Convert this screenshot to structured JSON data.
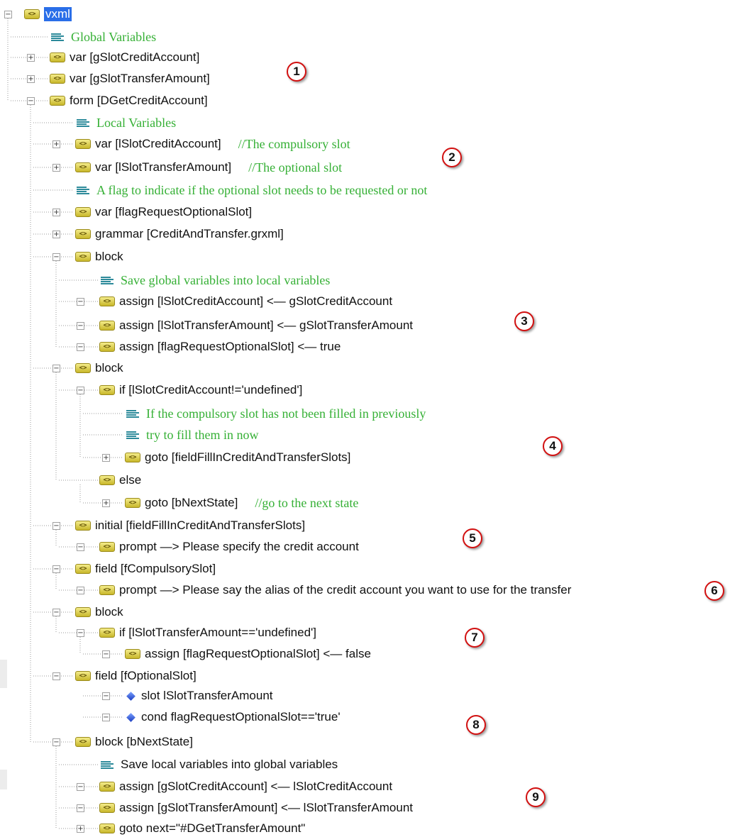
{
  "tree": [
    {
      "depth": 0,
      "icon": "tag",
      "text": "vxml",
      "expander": "minus",
      "selected": true
    },
    {
      "depth": 1,
      "icon": "comment",
      "text": "Global Variables",
      "kind": "comment"
    },
    {
      "depth": 1,
      "icon": "tag",
      "text": "var [gSlotCreditAccount]",
      "expander": "plus"
    },
    {
      "depth": 1,
      "icon": "tag",
      "text": "var [gSlotTransferAmount]",
      "expander": "plus"
    },
    {
      "depth": 1,
      "icon": "tag",
      "text": "form [DGetCreditAccount]",
      "expander": "minus"
    },
    {
      "depth": 2,
      "icon": "comment",
      "text": "Local Variables",
      "kind": "comment"
    },
    {
      "depth": 2,
      "icon": "tag",
      "text": "var [lSlotCreditAccount]",
      "expander": "plus",
      "comment": "//The compulsory slot"
    },
    {
      "depth": 2,
      "icon": "tag",
      "text": "var [lSlotTransferAmount]",
      "expander": "plus",
      "comment": "//The optional slot"
    },
    {
      "depth": 2,
      "icon": "comment",
      "text": "A flag to indicate if the optional slot needs to be requested or not",
      "kind": "comment"
    },
    {
      "depth": 2,
      "icon": "tag",
      "text": "var [flagRequestOptionalSlot]",
      "expander": "plus"
    },
    {
      "depth": 2,
      "icon": "tag",
      "text": "grammar [CreditAndTransfer.grxml]",
      "expander": "plus"
    },
    {
      "depth": 2,
      "icon": "tag",
      "text": "block",
      "expander": "minus"
    },
    {
      "depth": 3,
      "icon": "comment",
      "text": "Save global variables into local variables",
      "kind": "comment"
    },
    {
      "depth": 3,
      "icon": "tag",
      "text": "assign [lSlotCreditAccount]  <—   gSlotCreditAccount",
      "expander": "minus"
    },
    {
      "depth": 3,
      "icon": "tag",
      "text": "assign [lSlotTransferAmount] <—   gSlotTransferAmount",
      "expander": "minus"
    },
    {
      "depth": 3,
      "icon": "tag",
      "text": "assign [flagRequestOptionalSlot]  <—   true",
      "expander": "minus"
    },
    {
      "depth": 2,
      "icon": "tag",
      "text": "block",
      "expander": "minus"
    },
    {
      "depth": 3,
      "icon": "tag",
      "text": "if [lSlotCreditAccount!='undefined']",
      "expander": "minus"
    },
    {
      "depth": 4,
      "icon": "comment",
      "text": "If the compulsory slot has not been filled in previously",
      "kind": "comment"
    },
    {
      "depth": 4,
      "icon": "comment",
      "text": "try to fill them in now",
      "kind": "comment"
    },
    {
      "depth": 4,
      "icon": "tag",
      "text": "goto [fieldFillInCreditAndTransferSlots]",
      "expander": "plus"
    },
    {
      "depth": 3,
      "icon": "tag",
      "text": "else"
    },
    {
      "depth": 4,
      "icon": "tag",
      "text": "goto [bNextState]",
      "expander": "plus",
      "comment": "//go to the next state"
    },
    {
      "depth": 2,
      "icon": "tag",
      "text": "initial [fieldFillInCreditAndTransferSlots]",
      "expander": "minus"
    },
    {
      "depth": 3,
      "icon": "tag",
      "text": "prompt  —>  Please specify the credit account",
      "expander": "minus"
    },
    {
      "depth": 2,
      "icon": "tag",
      "text": "field [fCompulsorySlot]",
      "expander": "minus"
    },
    {
      "depth": 3,
      "icon": "tag",
      "text": "prompt  —>  Please say the alias of the credit account you want to use for the transfer",
      "expander": "minus"
    },
    {
      "depth": 2,
      "icon": "tag",
      "text": "block",
      "expander": "minus"
    },
    {
      "depth": 3,
      "icon": "tag",
      "text": "if [lSlotTransferAmount=='undefined']",
      "expander": "minus"
    },
    {
      "depth": 4,
      "icon": "tag",
      "text": "assign [flagRequestOptionalSlot] <— false",
      "expander": "minus"
    },
    {
      "depth": 2,
      "icon": "tag",
      "text": "field [fOptionalSlot]",
      "expander": "minus"
    },
    {
      "depth": 4,
      "icon": "diamond",
      "text": "slot   lSlotTransferAmount",
      "expander": "minus"
    },
    {
      "depth": 4,
      "icon": "diamond",
      "text": "cond   flagRequestOptionalSlot=='true'",
      "expander": "minus"
    },
    {
      "depth": 2,
      "icon": "tag",
      "text": "block [bNextState]",
      "expander": "minus"
    },
    {
      "depth": 3,
      "icon": "comment",
      "text": "Save local variables into global variables"
    },
    {
      "depth": 3,
      "icon": "tag",
      "text": "assign [gSlotCreditAccount]   <—    lSlotCreditAccount",
      "expander": "minus"
    },
    {
      "depth": 3,
      "icon": "tag",
      "text": "assign [gSlotTransferAmount]  <—   lSlotTransferAmount",
      "expander": "minus"
    },
    {
      "depth": 3,
      "icon": "tag",
      "text": "goto next=\"#DGetTransferAmount\"",
      "expander": "plus"
    }
  ],
  "callouts": [
    "1",
    "2",
    "3",
    "4",
    "5",
    "6",
    "7",
    "8",
    "9"
  ],
  "colors": {
    "comment": "#35b035",
    "selection": "#2a6ee8",
    "callout_border": "#d21010"
  },
  "icons": {
    "tag": "xml-tag-icon",
    "comment": "comment-lines-icon",
    "diamond": "blue-diamond-icon"
  }
}
